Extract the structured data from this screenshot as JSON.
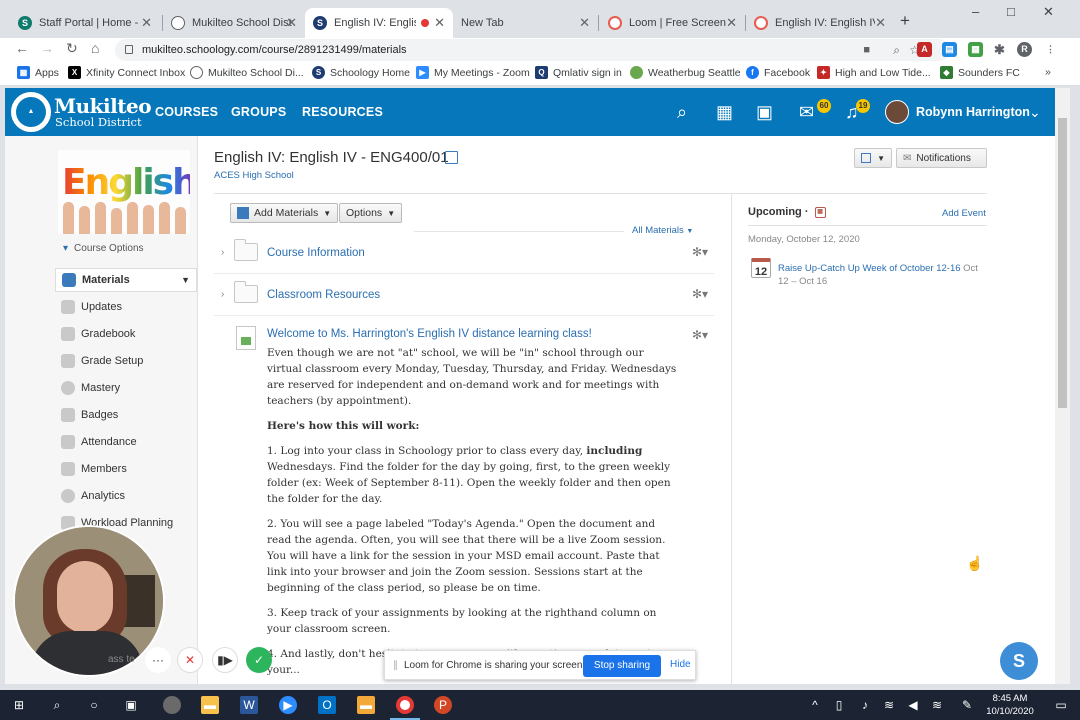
{
  "browser": {
    "tabs": [
      {
        "label": "Staff Portal | Home - H",
        "color": "#0f7b6c"
      },
      {
        "label": "Mukilteo School Distric",
        "color": "#5f6368"
      },
      {
        "label": "English IV: English",
        "color": "#1e3c72",
        "active": true
      },
      {
        "label": "New Tab",
        "color": ""
      },
      {
        "label": "Loom | Free Screen &",
        "color": "#e65c4f"
      },
      {
        "label": "English IV: English IV -",
        "color": "#e65c4f"
      }
    ],
    "new_tab_symbol": "+",
    "window_controls": [
      "–",
      "□",
      "✕"
    ],
    "url": "mukilteo.schoology.com/course/2891231499/materials",
    "bookmarks": [
      "Apps",
      "Xfinity Connect Inbox",
      "Mukilteo School Di...",
      "Schoology Home",
      "My Meetings - Zoom",
      "Qmlativ sign in",
      "Weatherbug Seattle",
      "Facebook",
      "High and Low Tide...",
      "Sounders FC"
    ],
    "bookmarks_overflow": "»"
  },
  "topnav": {
    "logo_line1": "Mukilteo",
    "logo_line2": "School District",
    "links": [
      "COURSES",
      "GROUPS",
      "RESOURCES"
    ],
    "mail_badge": "60",
    "notif_badge": "19",
    "user_name": "Robynn Harrington"
  },
  "sidebar": {
    "course_options": "Course Options",
    "image_word": "English",
    "items": [
      {
        "label": "Materials",
        "selected": true
      },
      {
        "label": "Updates"
      },
      {
        "label": "Gradebook"
      },
      {
        "label": "Grade Setup"
      },
      {
        "label": "Mastery"
      },
      {
        "label": "Badges"
      },
      {
        "label": "Attendance"
      },
      {
        "label": "Members"
      },
      {
        "label": "Analytics"
      },
      {
        "label": "Workload Planning"
      }
    ]
  },
  "course": {
    "title": "English IV: English IV - ENG400/01",
    "school": "ACES High School",
    "notifications_label": "Notifications"
  },
  "materials": {
    "add_materials_label": "Add Materials",
    "options_label": "Options",
    "filter_label": "All Materials",
    "folders": [
      {
        "name": "Course Information"
      },
      {
        "name": "Classroom Resources"
      }
    ],
    "post": {
      "title": "Welcome to Ms. Harrington's English IV distance learning class!",
      "p1": "Even though we are not \"at\" school, we will be \"in\" school through our virtual classroom every Monday, Tuesday, Thursday, and Friday. Wednesdays are reserved for independent and on-demand work and for meetings with teachers (by appointment).",
      "heading": "Here's how this will work:",
      "p2a": "1.  Log into your class in Schoology prior to class every day, ",
      "p2b": "including",
      "p2c": " Wednesdays. Find the folder for the day by going, first, to the green weekly folder (ex: Week of September 8-11). Open the weekly folder and then open the folder for the day.",
      "p3": "2.  You will see a page labeled \"Today's Agenda.\" Open the document and read the agenda. Often, you will see that there will be a live  Zoom session. You will have a link for the session in your MSD email account. Paste that link into your browser and join the Zoom session. Sessions start at the beginning of the class period, so please be on time.",
      "p4": "3. Keep track of your assignments by looking at the righthand column on your classroom screen.",
      "p5": "4. And lastly, don't hesitate to message me with questions... update, or type your..."
    }
  },
  "upcoming": {
    "title": "Upcoming",
    "add_event": "Add Event",
    "date_heading": "Monday, October 12, 2020",
    "event_day": "12",
    "event_title": "Raise Up-Catch Up Week of October 12-16",
    "event_range": "Oct 12 – Oct 16"
  },
  "loom": {
    "sharing_text": "Loom for Chrome is sharing your screen.",
    "stop_label": "Stop sharing",
    "hide_label": "Hide",
    "dots": "···",
    "cut_text": "ass  te"
  },
  "chat_bubble": "S",
  "taskbar": {
    "time": "8:45 AM",
    "date": "10/10/2020"
  }
}
